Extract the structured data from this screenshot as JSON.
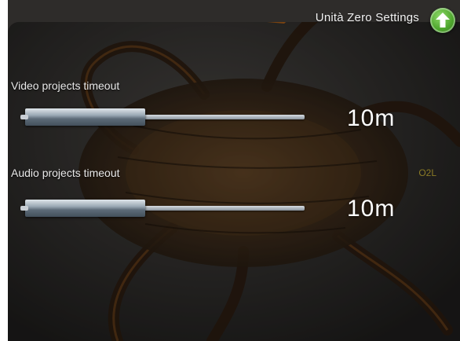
{
  "header": {
    "title": "Unità Zero Settings",
    "upload_icon": "up-arrow-circle-icon",
    "accent_color": "#4fa72e"
  },
  "video": {
    "label": "Video projects timeout",
    "value_text": "10m",
    "level": 0.43
  },
  "audio": {
    "label": "Audio projects timeout",
    "value_text": "10m",
    "level": 0.43,
    "tag": "O2L"
  }
}
